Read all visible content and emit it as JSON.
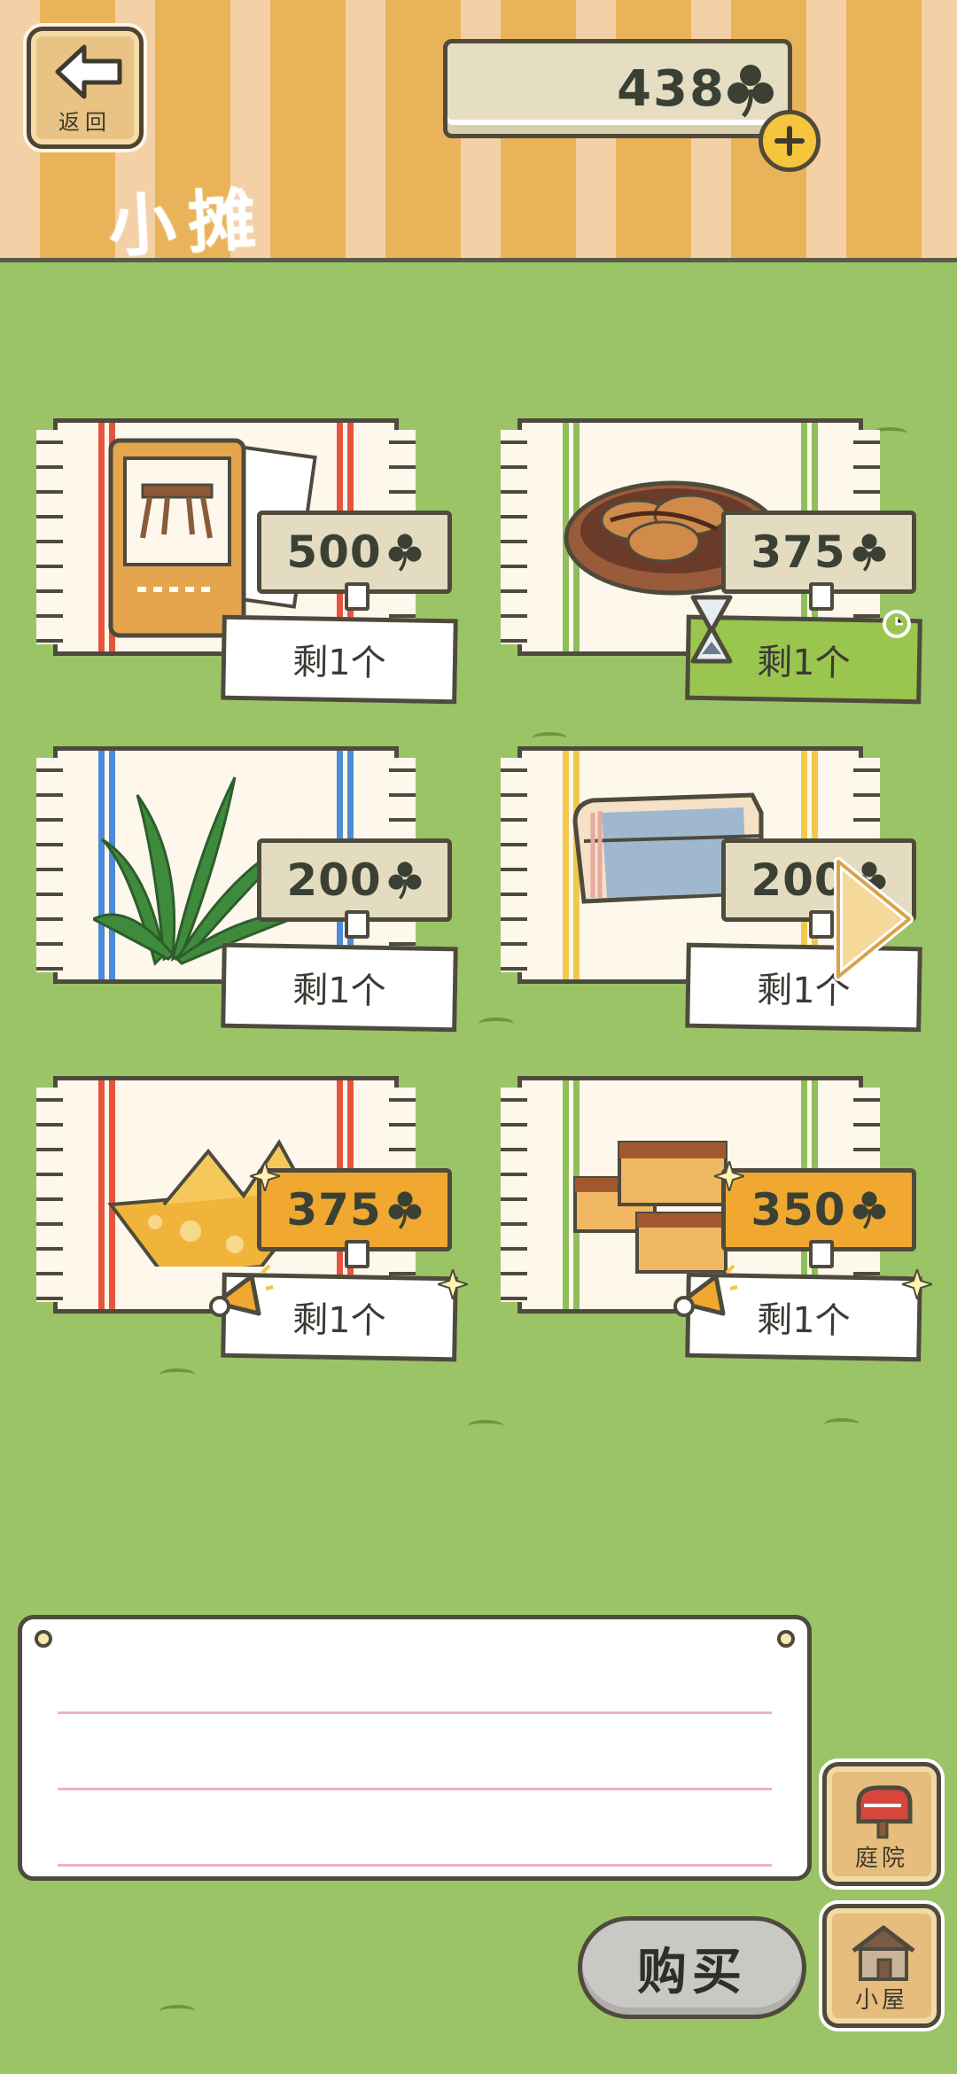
{
  "header": {
    "back_label": "返回",
    "title": "小摊",
    "coins": "438"
  },
  "items": [
    {
      "name": "table-card",
      "price": "500",
      "stock": "剩1个",
      "price_style": "normal",
      "badge": "none",
      "stripe_color": "#e8533e"
    },
    {
      "name": "pancakes",
      "price": "375",
      "stock": "剩1个",
      "price_style": "normal",
      "badge": "timer",
      "stripe_color": "#8fbf5a"
    },
    {
      "name": "leaf",
      "price": "200",
      "stock": "剩1个",
      "price_style": "normal",
      "badge": "none",
      "stripe_color": "#4d8ad8"
    },
    {
      "name": "towel",
      "price": "200",
      "stock": "剩1个",
      "price_style": "normal",
      "badge": "none",
      "stripe_color": "#f3c84a"
    },
    {
      "name": "paper-boat",
      "price": "375",
      "stock": "剩1个",
      "price_style": "hot",
      "badge": "megaphone",
      "stripe_color": "#e8533e"
    },
    {
      "name": "castella",
      "price": "350",
      "stock": "剩1个",
      "price_style": "hot",
      "badge": "megaphone",
      "stripe_color": "#8fbf5a"
    }
  ],
  "actions": {
    "buy_label": "购买",
    "yard_label": "庭院",
    "house_label": "小屋"
  },
  "colors": {
    "grass": "#9bc466",
    "price_hot": "#f0a830",
    "stock_timed": "#9ac54e"
  }
}
